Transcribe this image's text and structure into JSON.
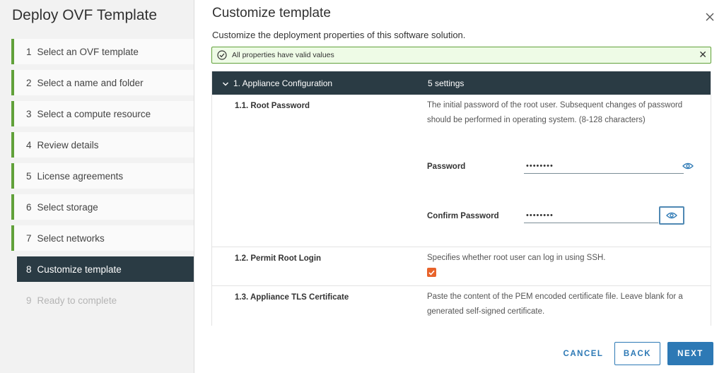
{
  "wizard": {
    "title": "Deploy OVF Template",
    "steps": [
      {
        "num": "1",
        "label": "Select an OVF template"
      },
      {
        "num": "2",
        "label": "Select a name and folder"
      },
      {
        "num": "3",
        "label": "Select a compute resource"
      },
      {
        "num": "4",
        "label": "Review details"
      },
      {
        "num": "5",
        "label": "License agreements"
      },
      {
        "num": "6",
        "label": "Select storage"
      },
      {
        "num": "7",
        "label": "Select networks"
      },
      {
        "num": "8",
        "label": "Customize template"
      },
      {
        "num": "9",
        "label": "Ready to complete"
      }
    ],
    "active_step": "8"
  },
  "page": {
    "title": "Customize template",
    "subtitle": "Customize the deployment properties of this software solution."
  },
  "alert": {
    "text": "All properties have valid values",
    "close": "✕"
  },
  "section": {
    "title": "1. Appliance Configuration",
    "count": "5 settings"
  },
  "settings": {
    "root_password": {
      "label": "1.1. Root Password",
      "description": "The initial password of the root user. Subsequent changes of password should be performed in operating system. (8-128 characters)",
      "password_label": "Password",
      "password_value": "••••••••",
      "confirm_label": "Confirm Password",
      "confirm_value": "••••••••"
    },
    "permit_root_login": {
      "label": "1.2. Permit Root Login",
      "description": "Specifies whether root user can log in using SSH.",
      "checked": true
    },
    "tls_certificate": {
      "label": "1.3. Appliance TLS Certificate",
      "description": "Paste the content of the PEM encoded certificate file. Leave blank for a generated self-signed certificate."
    }
  },
  "footer": {
    "cancel": "CANCEL",
    "back": "BACK",
    "next": "NEXT"
  },
  "colors": {
    "accent": "#2d79b5",
    "nav_active": "#2a3b44",
    "step_done": "#61a13a",
    "checkbox": "#e8632b"
  }
}
